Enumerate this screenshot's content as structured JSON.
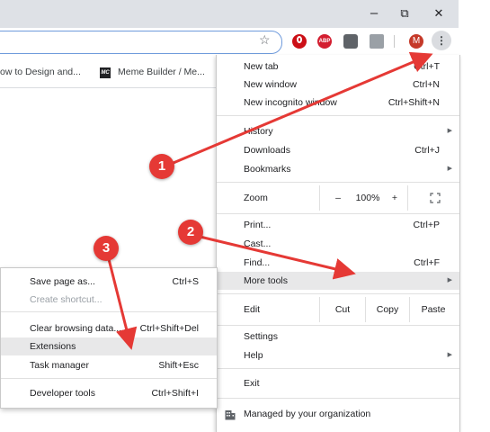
{
  "window": {
    "minimize": "–",
    "maximize": "⧉",
    "close": "✕"
  },
  "toolbar": {
    "star_icon": "star-icon",
    "extensions": [
      {
        "name": "opera-extension-icon",
        "text": "",
        "color": "#cc0f16"
      },
      {
        "name": "adblock-extension-icon",
        "text": "ABP",
        "color": "#d31d2f"
      },
      {
        "name": "puzzle-extension-icon",
        "text": "",
        "color": "#5f6368"
      },
      {
        "name": "gray-extension-icon",
        "text": "",
        "color": "#9aa0a6"
      }
    ],
    "avatar_letter": "M",
    "menu_glyph": "⋮"
  },
  "bookmarks": [
    {
      "label": "ow to Design and..."
    },
    {
      "label": "Meme Builder / Me...",
      "icon_text": "MC"
    }
  ],
  "menu": {
    "new_tab": {
      "label": "New tab",
      "shortcut": "Ctrl+T"
    },
    "new_window": {
      "label": "New window",
      "shortcut": "Ctrl+N"
    },
    "new_incognito": {
      "label": "New incognito window",
      "shortcut": "Ctrl+Shift+N"
    },
    "history": {
      "label": "History"
    },
    "downloads": {
      "label": "Downloads",
      "shortcut": "Ctrl+J"
    },
    "bookmarks": {
      "label": "Bookmarks"
    },
    "zoom": {
      "label": "Zoom",
      "minus": "–",
      "level": "100%",
      "plus": "+",
      "fullscreen_icon": "fullscreen-icon"
    },
    "print": {
      "label": "Print...",
      "shortcut": "Ctrl+P"
    },
    "cast": {
      "label": "Cast..."
    },
    "find": {
      "label": "Find...",
      "shortcut": "Ctrl+F"
    },
    "more_tools": {
      "label": "More tools"
    },
    "edit": {
      "label": "Edit",
      "cut": "Cut",
      "copy": "Copy",
      "paste": "Paste"
    },
    "settings": {
      "label": "Settings"
    },
    "help": {
      "label": "Help"
    },
    "exit": {
      "label": "Exit"
    },
    "managed": {
      "label": "Managed by your organization"
    }
  },
  "submenu": {
    "save_page": {
      "label": "Save page as...",
      "shortcut": "Ctrl+S"
    },
    "create_shortcut": {
      "label": "Create shortcut..."
    },
    "clear_data": {
      "label": "Clear browsing data...",
      "shortcut": "Ctrl+Shift+Del"
    },
    "extensions": {
      "label": "Extensions"
    },
    "task_manager": {
      "label": "Task manager",
      "shortcut": "Shift+Esc"
    },
    "developer_tools": {
      "label": "Developer tools",
      "shortcut": "Ctrl+Shift+I"
    }
  },
  "annotations": {
    "step1": "1",
    "step2": "2",
    "step3": "3",
    "arrow_color": "#e53935"
  }
}
